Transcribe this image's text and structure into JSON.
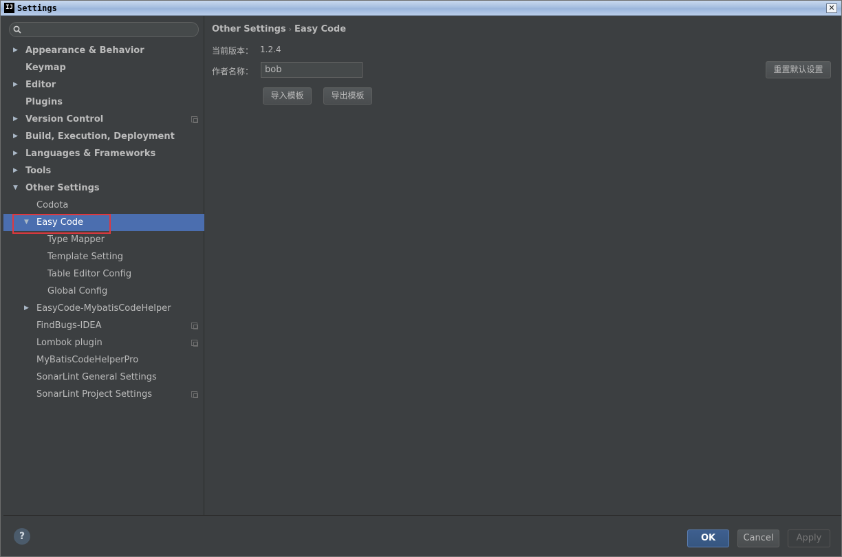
{
  "window": {
    "title": "Settings",
    "app_icon": "IJ",
    "close_glyph": "✕"
  },
  "search": {
    "placeholder": ""
  },
  "sidebar": {
    "items": [
      {
        "label": "Appearance & Behavior",
        "expand": "collapsed"
      },
      {
        "label": "Keymap"
      },
      {
        "label": "Editor",
        "expand": "collapsed"
      },
      {
        "label": "Plugins"
      },
      {
        "label": "Version Control",
        "expand": "collapsed",
        "project_icon": true
      },
      {
        "label": "Build, Execution, Deployment",
        "expand": "collapsed"
      },
      {
        "label": "Languages & Frameworks",
        "expand": "collapsed"
      },
      {
        "label": "Tools",
        "expand": "collapsed"
      },
      {
        "label": "Other Settings",
        "expand": "expanded"
      },
      {
        "label": "Codota"
      },
      {
        "label": "Easy Code",
        "expand": "expanded",
        "selected": true
      },
      {
        "label": "Type Mapper"
      },
      {
        "label": "Template Setting"
      },
      {
        "label": "Table Editor Config"
      },
      {
        "label": "Global Config"
      },
      {
        "label": "EasyCode-MybatisCodeHelper",
        "expand": "collapsed"
      },
      {
        "label": "FindBugs-IDEA",
        "project_icon": true
      },
      {
        "label": "Lombok plugin",
        "project_icon": true
      },
      {
        "label": "MyBatisCodeHelperPro"
      },
      {
        "label": "SonarLint General Settings"
      },
      {
        "label": "SonarLint Project Settings",
        "project_icon": true
      }
    ]
  },
  "main": {
    "breadcrumb": {
      "parent": "Other Settings",
      "separator": "›",
      "current": "Easy Code"
    },
    "version_label": "当前版本：",
    "version_value": "1.2.4",
    "author_label": "作者名称：",
    "author_value": "bob",
    "reset_button": "重置默认设置",
    "import_button": "导入模板",
    "export_button": "导出模板"
  },
  "footer": {
    "help": "?",
    "ok": "OK",
    "cancel": "Cancel",
    "apply": "Apply"
  },
  "colors": {
    "background": "#3c3f41",
    "selection": "#4b6eaf",
    "highlight": "#e0383e",
    "text": "#bbbbbb"
  }
}
